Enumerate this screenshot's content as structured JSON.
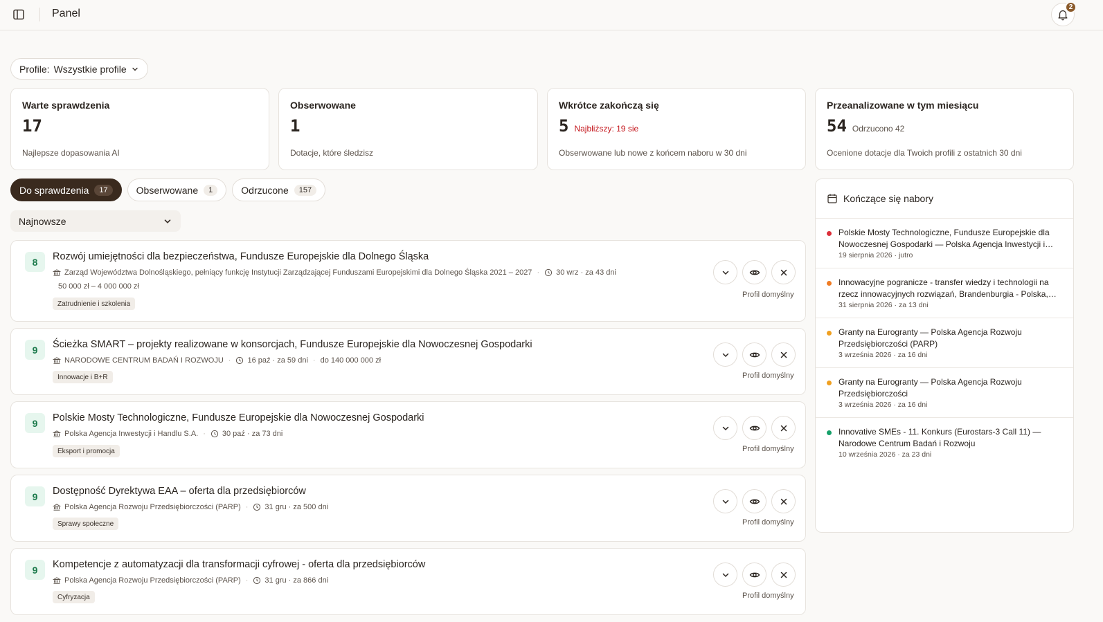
{
  "header": {
    "title": "Panel",
    "notification_count": "2"
  },
  "profile_filter": {
    "label": "Profile:",
    "value": "Wszystkie profile"
  },
  "stats": [
    {
      "title": "Warte sprawdzenia",
      "value": "17",
      "extra": "",
      "desc": "Najlepsze dopasowania AI"
    },
    {
      "title": "Obserwowane",
      "value": "1",
      "extra": "",
      "desc": "Dotacje, które śledzisz"
    },
    {
      "title": "Wkrótce zakończą się",
      "value": "5",
      "extra": "Najbliższy: 19 sie",
      "desc": "Obserwowane lub nowe z końcem naboru w 30 dni"
    },
    {
      "title": "Przeanalizowane w tym miesiącu",
      "value": "54",
      "extra": "Odrzucono 42",
      "desc": "Ocenione dotacje dla Twoich profili z ostatnich 30 dni"
    }
  ],
  "tabs": [
    {
      "label": "Do sprawdzenia",
      "count": "17"
    },
    {
      "label": "Obserwowane",
      "count": "1"
    },
    {
      "label": "Odrzucone",
      "count": "157"
    }
  ],
  "sort": {
    "value": "Najnowsze"
  },
  "grants": [
    {
      "score": "8",
      "title": "Rozwój umiejętności dla bezpieczeństwa, Fundusze Europejskie dla Dolnego Śląska",
      "institution": "Zarząd Województwa Dolnośląskiego, pełniący funkcję Instytucji Zarządzającej Funduszami Europejskimi dla Dolnego Śląska 2021 – 2027",
      "deadline": "30 wrz · za 43 dni",
      "amount": "50 000 zł – 4 000 000 zł",
      "tag": "Zatrudnienie i szkolenia",
      "profile": "Profil domyślny"
    },
    {
      "score": "9",
      "title": "Ścieżka SMART – projekty realizowane w konsorcjach, Fundusze Europejskie dla Nowoczesnej Gospodarki",
      "institution": "NARODOWE CENTRUM BADAŃ I ROZWOJU",
      "deadline": "16 paź · za 59 dni",
      "amount": "do 140 000 000 zł",
      "tag": "Innowacje i B+R",
      "profile": "Profil domyślny"
    },
    {
      "score": "9",
      "title": "Polskie Mosty Technologiczne, Fundusze Europejskie dla Nowoczesnej Gospodarki",
      "institution": "Polska Agencja Inwestycji i Handlu S.A.",
      "deadline": "30 paź · za 73 dni",
      "amount": "",
      "tag": "Eksport i promocja",
      "profile": "Profil domyślny"
    },
    {
      "score": "9",
      "title": "Dostępność Dyrektywa EAA – oferta dla przedsiębiorców",
      "institution": "Polska Agencja Rozwoju Przedsiębiorczości (PARP)",
      "deadline": "31 gru · za 500 dni",
      "amount": "",
      "tag": "Sprawy społeczne",
      "profile": "Profil domyślny"
    },
    {
      "score": "9",
      "title": "Kompetencje z automatyzacji dla transformacji cyfrowej - oferta dla przedsiębiorców",
      "institution": "Polska Agencja Rozwoju Przedsiębiorczości (PARP)",
      "deadline": "31 gru · za 866 dni",
      "amount": "",
      "tag": "Cyfryzacja",
      "profile": "Profil domyślny"
    }
  ],
  "closing": {
    "title": "Kończące się nabory",
    "items": [
      {
        "title": "Polskie Mosty Technologiczne, Fundusze Europejskie dla Nowoczesnej Gospodarki — Polska Agencja Inwestycji i Handlu S.A.",
        "date": "19 sierpnia 2026 · jutro",
        "color": "#dc2f3a"
      },
      {
        "title": "Innowacyjne pogranicze - transfer wiedzy i technologii na rzecz innowacyjnych rozwiązań, Brandenburgia - Polska, Interreg",
        "date": "31 sierpnia 2026 · za 13 dni",
        "color": "#f07c24"
      },
      {
        "title": "Granty na Eurogranty — Polska Agencja Rozwoju Przedsiębiorczości (PARP)",
        "date": "3 września 2026 · za 16 dni",
        "color": "#f0a020"
      },
      {
        "title": "Granty na Eurogranty — Polska Agencja Rozwoju Przedsiębiorczości",
        "date": "3 września 2026 · za 16 dni",
        "color": "#f0a020"
      },
      {
        "title": "Innovative SMEs - 11. Konkurs (Eurostars-3 Call 11) — Narodowe Centrum Badań i Rozwoju",
        "date": "10 września 2026 · za 23 dni",
        "color": "#16a06a"
      }
    ]
  }
}
